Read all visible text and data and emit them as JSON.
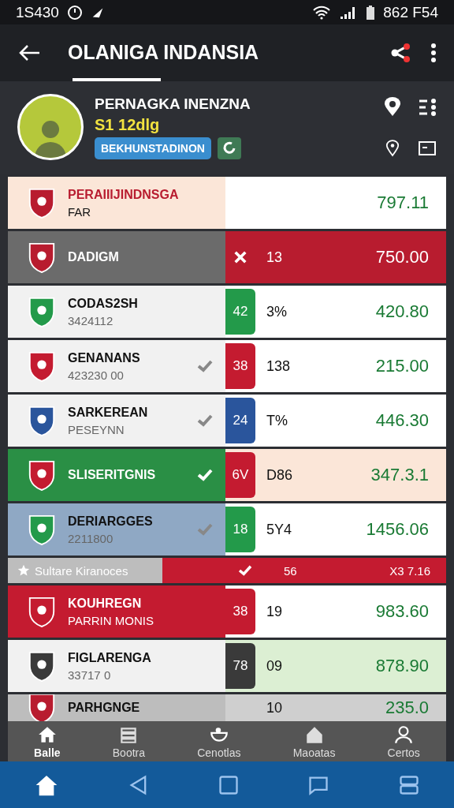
{
  "status_bar": {
    "time": "1S430",
    "right_text": "862 F54"
  },
  "app_bar": {
    "title": "OLANIGA INDANSIA"
  },
  "profile": {
    "name": "PERNAGKA INENZNA",
    "subtitle": "S1 12dlg",
    "tag": "BEKHUNSTADINON"
  },
  "rows": [
    {
      "kind": "peach",
      "name": "PERAIIIJINDNSGA",
      "sub": "FAR",
      "checked": false,
      "crossed": false,
      "value": "797.11"
    },
    {
      "kind": "alert",
      "name": "DADIGM",
      "checked": false,
      "crossed": true,
      "stat": "13",
      "value": "750.00"
    },
    {
      "kind": "plain",
      "name": "CODAS2SH",
      "sub": "3424112",
      "checked": false,
      "crossed": false,
      "badge": "42",
      "color": "#239a4a",
      "stat": "3%",
      "value": "420.80"
    },
    {
      "kind": "plain",
      "name": "GENANANS",
      "sub": "423230 00",
      "checked": true,
      "crossed": false,
      "badge": "38",
      "color": "#c41b30",
      "stat": "138",
      "value": "215.00"
    },
    {
      "kind": "plain",
      "name": "SARKEREAN",
      "sub": "PESEYNN",
      "checked": true,
      "crossed": false,
      "badge": "24",
      "color": "#2a559c",
      "stat": "T%",
      "value": "446.30"
    },
    {
      "kind": "green",
      "name": "SLISERITGNIS",
      "checked": true,
      "crossed": false,
      "badge": "6V",
      "color": "#c41b30",
      "stat": "D86",
      "value": "347.3.1"
    },
    {
      "kind": "blue",
      "name": "DERIARGGES",
      "sub": "2211800",
      "checked": true,
      "crossed": false,
      "badge": "18",
      "color": "#239a4a",
      "stat": "5Y4",
      "value": "1456.06"
    },
    {
      "kind": "section",
      "name": "Sultare Kiranoces",
      "checked": true,
      "crossed": false,
      "stat": "56",
      "value": "X3 7.16"
    },
    {
      "kind": "red",
      "name": "KOUHREGN",
      "sub": "PARRIN MONIS",
      "checked": false,
      "crossed": false,
      "badge": "38",
      "color": "#c41b30",
      "stat": "19",
      "value": "983.60"
    },
    {
      "kind": "mint",
      "name": "FIGLARENGA",
      "sub": "33717 0",
      "checked": false,
      "crossed": false,
      "badge": "78",
      "color": "#3a3a3a",
      "stat": "09",
      "value": "878.90"
    },
    {
      "kind": "dim",
      "name": "PARHGNGE",
      "checked": false,
      "crossed": false,
      "stat": "10",
      "value": "235.0"
    }
  ],
  "bottom_tabs": [
    {
      "label": "Balle",
      "selected": true
    },
    {
      "label": "Bootra",
      "selected": false
    },
    {
      "label": "Cenotlas",
      "selected": false
    },
    {
      "label": "Maoatas",
      "selected": false
    },
    {
      "label": "Certos",
      "selected": false
    }
  ]
}
